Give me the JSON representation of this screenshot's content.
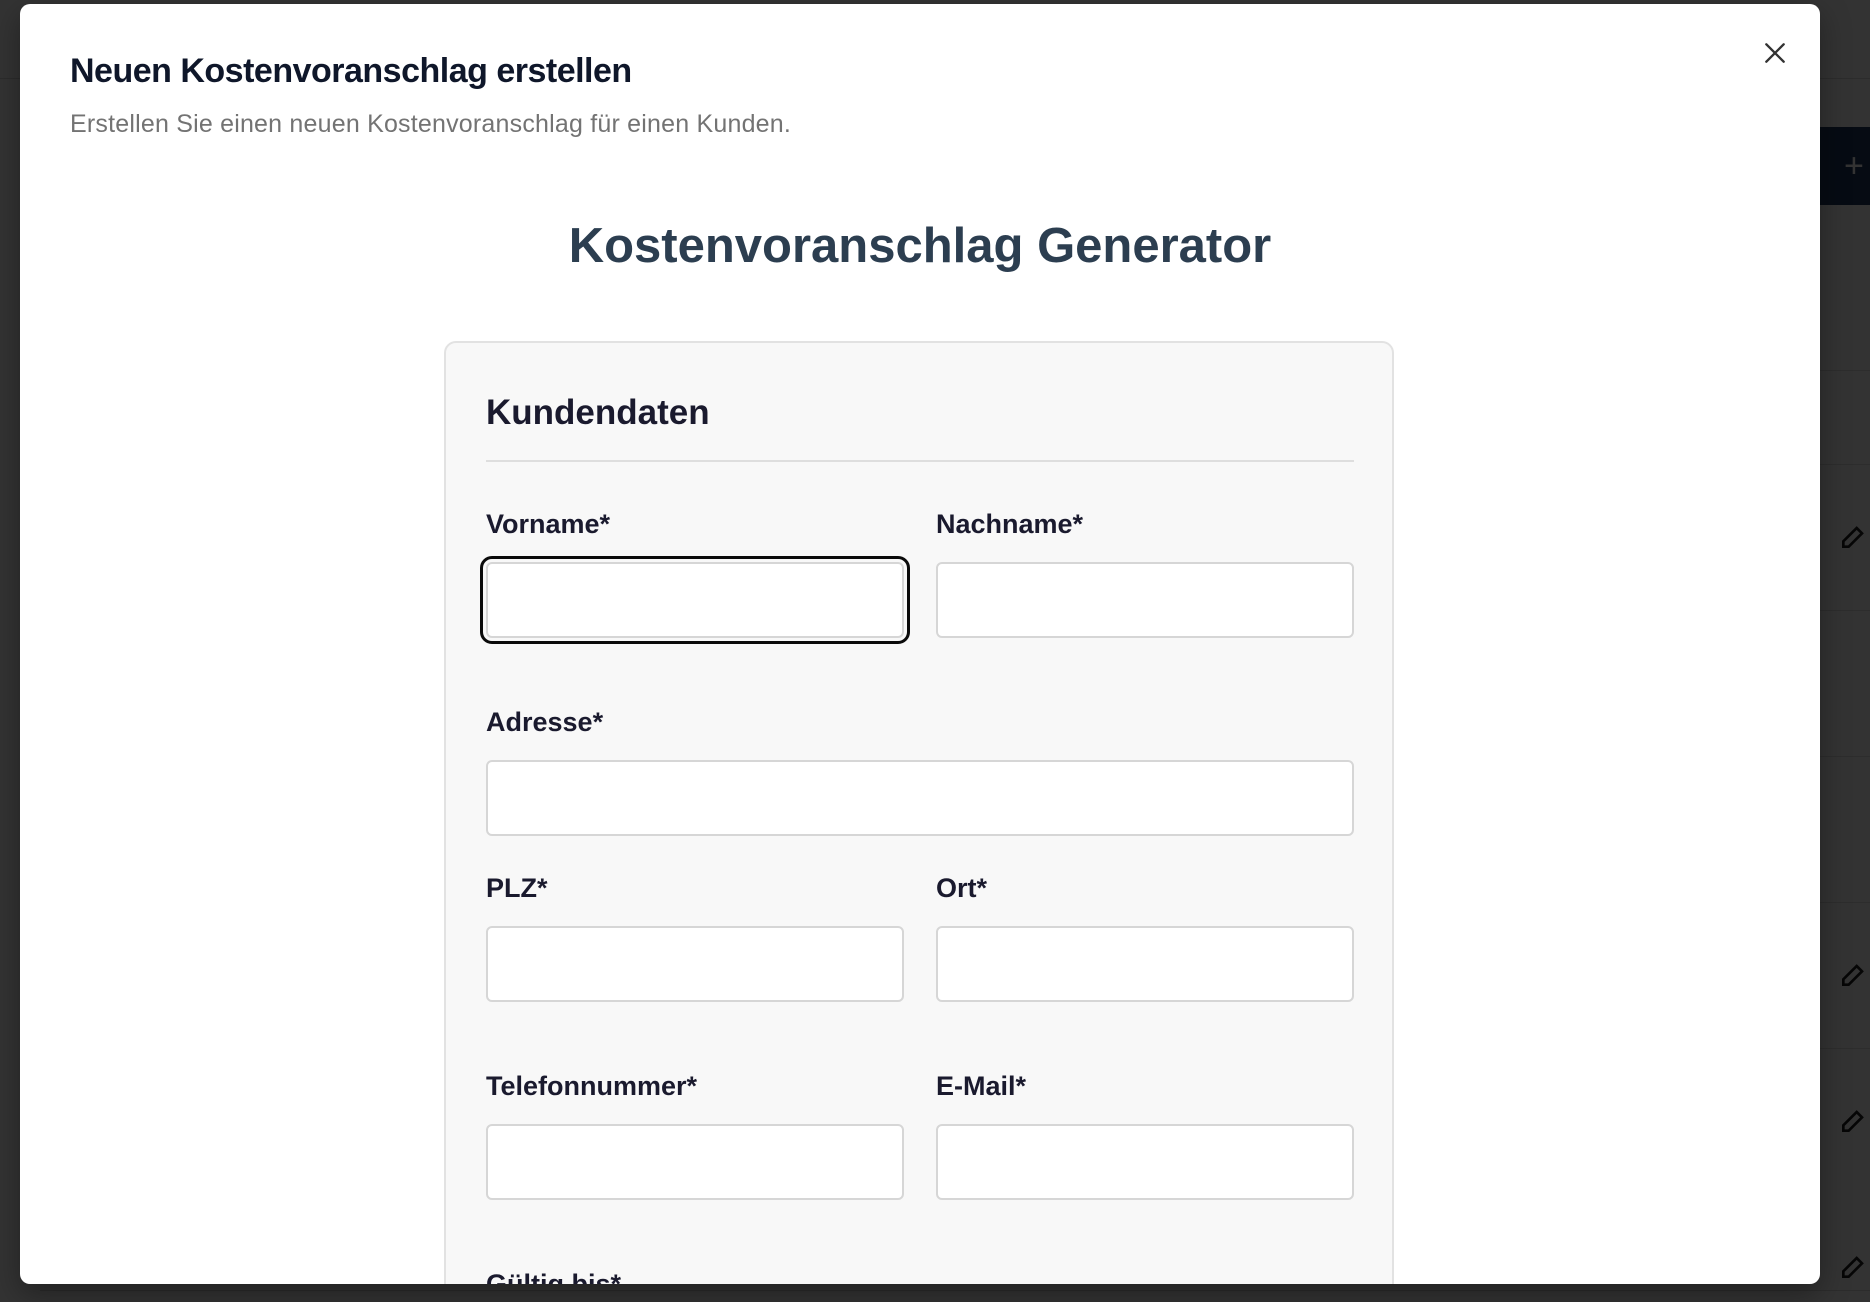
{
  "dialog": {
    "title": "Neuen Kostenvoranschlag erstellen",
    "description": "Erstellen Sie einen neuen Kostenvoranschlag für einen Kunden.",
    "close_icon": "close-icon"
  },
  "generator": {
    "title": "Kostenvoranschlag Generator"
  },
  "customer_section": {
    "title": "Kundendaten",
    "fields": {
      "vorname": {
        "label": "Vorname*",
        "value": ""
      },
      "nachname": {
        "label": "Nachname*",
        "value": ""
      },
      "adresse": {
        "label": "Adresse*",
        "value": ""
      },
      "plz": {
        "label": "PLZ*",
        "value": ""
      },
      "ort": {
        "label": "Ort*",
        "value": ""
      },
      "telefon": {
        "label": "Telefonnummer*",
        "value": ""
      },
      "email": {
        "label": "E-Mail*",
        "value": ""
      },
      "gueltig_bis": {
        "label": "Gültig bis*"
      }
    }
  },
  "background": {
    "add_icon": "plus-icon",
    "row_icon": "edit-icon"
  },
  "colors": {
    "accent": "#1e3a5f",
    "title": "#2c3e50",
    "overlay": "#000000"
  }
}
